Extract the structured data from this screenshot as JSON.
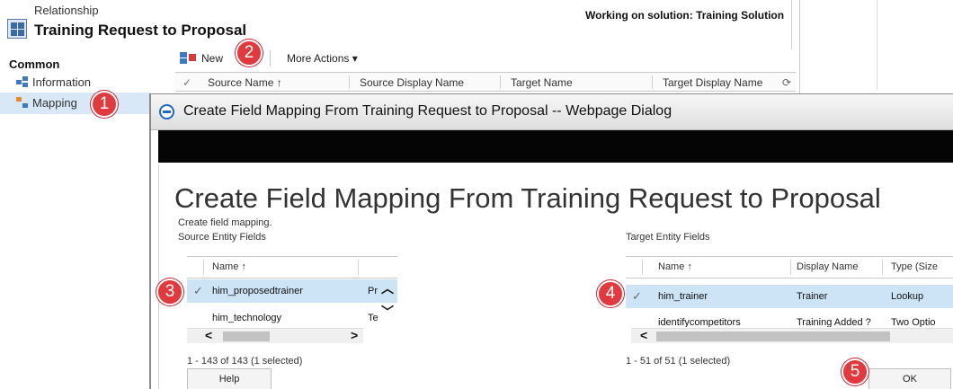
{
  "relationship": {
    "type_label": "Relationship",
    "title": "Training Request to Proposal",
    "solution_text": "Working on solution: Training Solution"
  },
  "sidebar": {
    "heading": "Common",
    "items": [
      {
        "label": "Information"
      },
      {
        "label": "Mapping"
      }
    ]
  },
  "toolbar": {
    "new_label": "New",
    "more_actions_label": "More Actions ▾"
  },
  "grid": {
    "columns": [
      "Source Name ↑",
      "Source Display Name",
      "Target Name",
      "Target Display Name"
    ]
  },
  "dialog": {
    "window_title": "Create Field Mapping From Training Request to Proposal -- Webpage Dialog",
    "heading": "Create Field Mapping From Training Request to Proposal",
    "subtitle": "Create field mapping.",
    "source": {
      "label": "Source Entity Fields",
      "columns": [
        "Name ↑",
        ""
      ],
      "rows": [
        {
          "name": "him_proposedtrainer",
          "display": "Pr",
          "selected": true
        },
        {
          "name": "him_technology",
          "display": "Te",
          "selected": false
        }
      ],
      "count_text": "1 - 143 of 143 (1 selected)"
    },
    "target": {
      "label": "Target Entity Fields",
      "columns": [
        "Name ↑",
        "Display Name",
        "Type (Size"
      ],
      "rows": [
        {
          "name": "him_trainer",
          "display": "Trainer",
          "type": "Lookup",
          "selected": true
        },
        {
          "name": "identifycompetitors",
          "display": "Training Added ?",
          "type": "Two Optio",
          "selected": false
        }
      ],
      "count_text": "1 - 51 of 51 (1 selected)"
    },
    "help_label": "Help",
    "ok_label": "OK"
  },
  "badges": [
    "1",
    "2",
    "3",
    "4",
    "5"
  ],
  "colors": {
    "badge": "#e0393e",
    "selected_row": "#cde3f6",
    "accent": "#3c79c2"
  }
}
